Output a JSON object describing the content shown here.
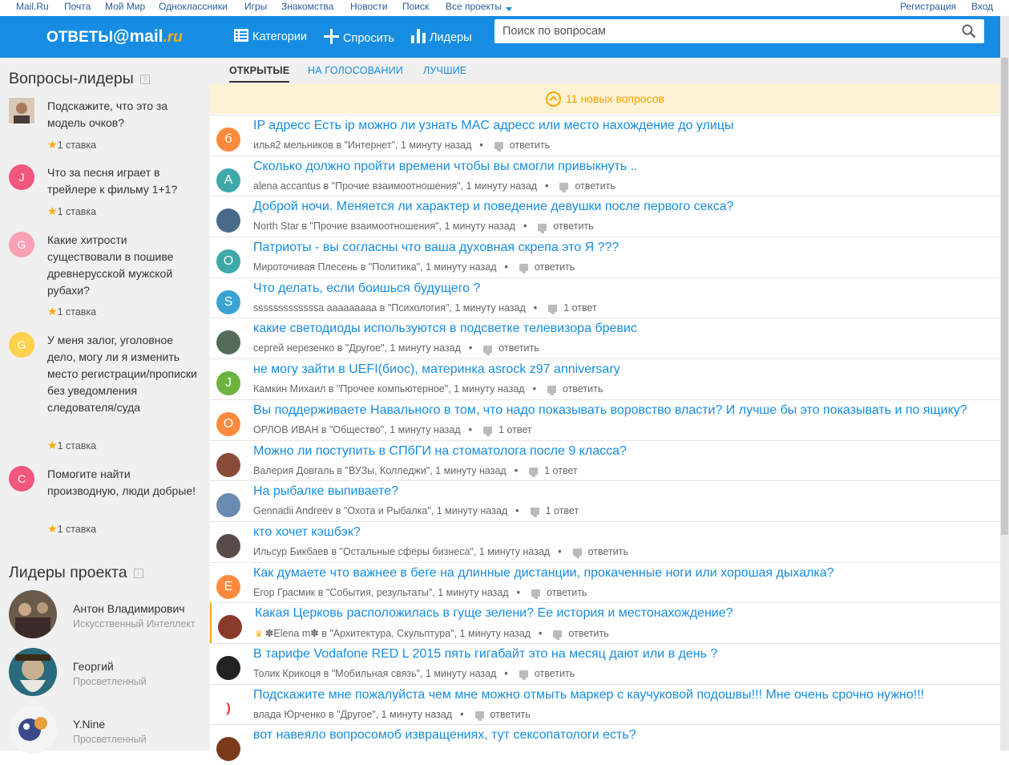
{
  "topbar": {
    "links": [
      "Mail.Ru",
      "Почта",
      "Мой Мир",
      "Одноклассники",
      "Игры",
      "Знакомства",
      "Новости",
      "Поиск",
      "Все проекты"
    ],
    "register": "Регистрация",
    "login": "Вход"
  },
  "header": {
    "logo_main": "ответы",
    "logo_at": "@mail",
    "logo_ru": ".ru",
    "categories": "Категории",
    "ask": "Спросить",
    "leaders": "Лидеры",
    "search_placeholder": "Поиск по вопросам"
  },
  "sidebar": {
    "leaders_title": "Вопросы-лидеры",
    "leader_questions": [
      {
        "avatar": "",
        "color": "#7a5c4a",
        "text": "Подскажите, что это за модель очков?",
        "stake": "1 ставка"
      },
      {
        "avatar": "J",
        "color": "#f0577b",
        "text": "Что за песня играет в трейлере к фильму 1+1?",
        "stake": "1 ставка"
      },
      {
        "avatar": "G",
        "color": "#f9a0b4",
        "text": "Какие хитрости существовали в пошиве древнерусской мужской рубахи?",
        "stake": "1 ставка"
      },
      {
        "avatar": "G",
        "color": "#ffd14c",
        "text": "У меня залог, уголовное дело, могу ли я изменить место регистрации/прописки без уведомления следователя/суда",
        "stake": "1 ставка"
      },
      {
        "avatar": "C",
        "color": "#f0577b",
        "text": "Помогите найти производную, люди добрые!",
        "stake": "1 ставка"
      }
    ],
    "project_title": "Лидеры проекта",
    "project_leaders": [
      {
        "name": "Антон Владимирович",
        "rank": "Искусственный Интеллект"
      },
      {
        "name": "Георгий",
        "rank": "Просветленный"
      },
      {
        "name": "Y.Nine",
        "rank": "Просветленный"
      }
    ]
  },
  "tabs": [
    "ОТКРЫТЫЕ",
    "НА ГОЛОСОВАНИИ",
    "ЛУЧШИЕ"
  ],
  "new_questions": "11 новых вопросов",
  "questions": [
    {
      "avatar": "б",
      "color": "#ff8a3d",
      "title": "IP адресс Есть ip можно ли узнать MAC адресс или место нахождение до улицы",
      "meta": "илья2 мельников в \"Интернет\", 1 минуту назад",
      "answers": "ответить"
    },
    {
      "avatar": "A",
      "color": "#3fa8a8",
      "title": "Сколько должно пройти времени чтобы вы смогли привыкнуть ..",
      "meta": "alena accantus в \"Прочие взаимоотношения\", 1 минуту назад",
      "answers": "ответить"
    },
    {
      "avatar": "",
      "color": "#4a6a8a",
      "title": "Доброй ночи. Меняется ли характер и поведение девушки после первого секса?",
      "meta": "North Star в \"Прочие взаимоотношения\", 1 минуту назад",
      "answers": "ответить"
    },
    {
      "avatar": "О",
      "color": "#3fa8a8",
      "title": "Патриоты - вы согласны что ваша духовная скрепа это Я ???",
      "meta": "Мироточивая Плесень в \"Политика\", 1 минуту назад",
      "answers": "ответить"
    },
    {
      "avatar": "S",
      "color": "#3aa3d4",
      "title": "Что делать, если боишься будущего ?",
      "meta": "sssssssssssssa ааааааааа в \"Психология\", 1 минуту назад",
      "answers": "1 ответ"
    },
    {
      "avatar": "",
      "color": "#556b5a",
      "title": "какие светодиоды используются в подсветке телевизора бревис",
      "meta": "сергей нерезенко в \"Другое\", 1 минуту назад",
      "answers": "ответить"
    },
    {
      "avatar": "J",
      "color": "#6cb33f",
      "title": "не могу зайти в UEFI(биос), материнка asrock z97 anniversary",
      "meta": "Камкин Михаил в \"Прочее компьютерное\", 1 минуту назад",
      "answers": "ответить"
    },
    {
      "avatar": "О",
      "color": "#ff8a3d",
      "title": "Вы поддерживаете Навального в том, что надо показывать воровство власти? И лучше бы это показывать и по ящику?",
      "meta": "ОРЛОВ ИВАН в \"Общество\", 1 минуту назад",
      "answers": "1 ответ"
    },
    {
      "avatar": "",
      "color": "#8a4a3a",
      "title": "Можно ли поступить в СПбГИ на стоматолога после 9 класса?",
      "meta": "Валерия Довгаль в \"ВУЗы, Колледжи\", 1 минуту назад",
      "answers": "1 ответ"
    },
    {
      "avatar": "",
      "color": "#6a8ab0",
      "title": "На рыбалке выпиваете?",
      "meta": "Gennadii Andreev в \"Охота и Рыбалка\", 1 минуту назад",
      "answers": "1 ответ"
    },
    {
      "avatar": "",
      "color": "#5a4a4a",
      "title": "кто хочет кэшбэк?",
      "meta": "Ильсур Бикбаев в \"Остальные сферы бизнеса\", 1 минуту назад",
      "answers": "ответить"
    },
    {
      "avatar": "E",
      "color": "#ff8a3d",
      "title": "Как думаете что важнее в беге на длинные дистанции, прокаченные ноги или хорошая дыхалка?",
      "meta": "Егор Грасмик в \"События, результаты\", 1 минуту назад",
      "answers": "ответить"
    },
    {
      "avatar": "",
      "color": "#8a3a2a",
      "title": "Какая Церковь расположилась в гуще зелени? Ее история и местонахождение?",
      "meta": "✽Elena m✽ в \"Архитектура, Скульптура\", 1 минуту назад",
      "answers": "ответить",
      "highlight": true
    },
    {
      "avatar": "",
      "color": "#222222",
      "title": "В тарифе Vodafone RED L 2015 пять гигабайт это на месяц дают или в день ?",
      "meta": "Толик Крикоця в \"Мобильная связь\", 1 минуту назад",
      "answers": "ответить"
    },
    {
      "avatar": ")",
      "color": "#ffffff",
      "title": "Подскажите мне пожалуйста чем мне можно отмыть маркер с каучуковой подошвы!!! Мне очень срочно нужно!!!",
      "meta": "влада Юрченко в \"Другое\", 1 минуту назад",
      "answers": "ответить"
    },
    {
      "avatar": "",
      "color": "#7a3a1a",
      "title": "вот навеяло вопросомоб извращениях, тут сексопатологи есть?",
      "meta": "",
      "answers": ""
    }
  ]
}
